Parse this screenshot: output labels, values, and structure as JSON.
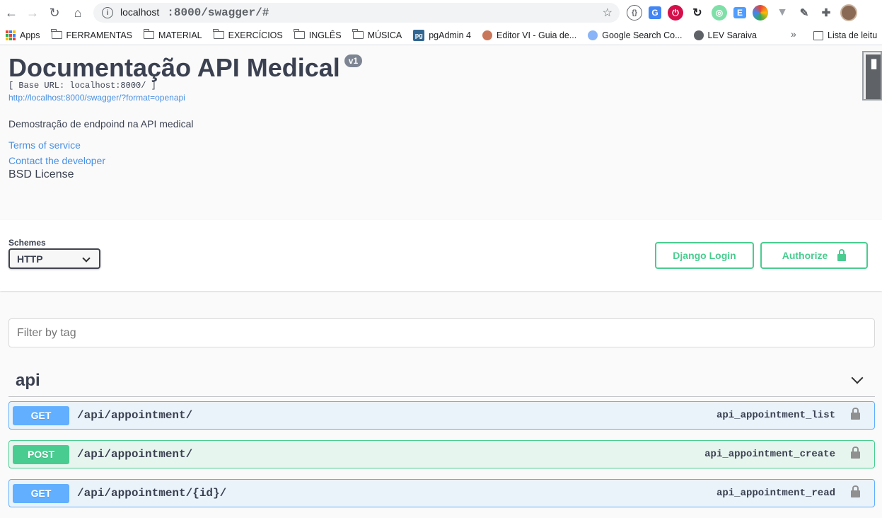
{
  "browser": {
    "url_host": "localhost",
    "url_rest": ":8000/swagger/#",
    "bookmarks": [
      {
        "label": "Apps",
        "icon": "apps-grid-icon"
      },
      {
        "label": "FERRAMENTAS",
        "icon": "folder-icon"
      },
      {
        "label": "MATERIAL",
        "icon": "folder-icon"
      },
      {
        "label": "EXERCÍCIOS",
        "icon": "folder-icon"
      },
      {
        "label": "INGLÊS",
        "icon": "folder-icon"
      },
      {
        "label": "MÚSICA",
        "icon": "folder-icon"
      },
      {
        "label": "pgAdmin 4",
        "icon": "pgadmin-icon"
      },
      {
        "label": "Editor VI - Guia de...",
        "icon": "avatar-icon"
      },
      {
        "label": "Google Search Co...",
        "icon": "search-console-icon"
      },
      {
        "label": "LEV Saraiva",
        "icon": "globe-icon"
      }
    ],
    "more": "»",
    "reading_list": "Lista de leitu"
  },
  "info": {
    "title": "Documentação API Medical",
    "version": "v1",
    "base_url": "[ Base URL: localhost:8000/ ]",
    "spec_link": "http://localhost:8000/swagger/?format=openapi",
    "description": "Demostração de endpoind na API medical",
    "terms": "Terms of service",
    "contact": "Contact the developer",
    "license": "BSD License"
  },
  "schemes": {
    "label": "Schemes",
    "selected": "HTTP"
  },
  "buttons": {
    "login": "Django Login",
    "authorize": "Authorize"
  },
  "filter": {
    "placeholder": "Filter by tag"
  },
  "tag": {
    "name": "api",
    "operations": [
      {
        "method": "GET",
        "path": "/api/appointment/",
        "operation_id": "api_appointment_list"
      },
      {
        "method": "POST",
        "path": "/api/appointment/",
        "operation_id": "api_appointment_create"
      },
      {
        "method": "GET",
        "path": "/api/appointment/{id}/",
        "operation_id": "api_appointment_read"
      }
    ]
  },
  "colors": {
    "get": "#61affe",
    "post": "#49cc90",
    "link": "#4990e2"
  }
}
